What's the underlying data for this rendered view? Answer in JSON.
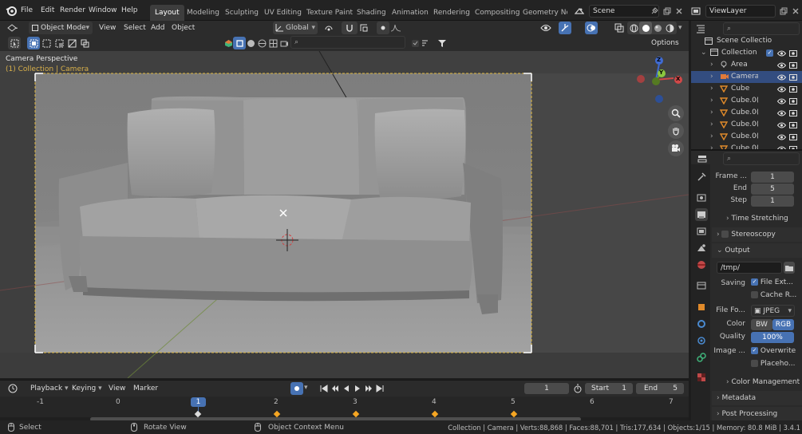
{
  "app": {
    "menus": [
      "File",
      "Edit",
      "Render",
      "Window",
      "Help"
    ],
    "workspaces": [
      "Layout",
      "Modeling",
      "Sculpting",
      "UV Editing",
      "Texture Paint",
      "Shading",
      "Animation",
      "Rendering",
      "Compositing",
      "Geometry Noc"
    ],
    "active_workspace": "Layout",
    "scene_name": "Scene",
    "view_layer": "ViewLayer"
  },
  "viewport_header": {
    "mode": "Object Mode",
    "menus": [
      "View",
      "Select",
      "Add",
      "Object"
    ],
    "transform_orientation": "Global",
    "options_label": "Options"
  },
  "viewport": {
    "camera_label": "Camera Perspective",
    "collection_label": "(1) Collection | Camera",
    "axis_x": "X",
    "axis_y": "Y",
    "axis_z": "Z"
  },
  "outliner": {
    "root": "Scene Collectio",
    "items": [
      {
        "name": "Collection",
        "type": "collection",
        "selected": false
      },
      {
        "name": "Area",
        "type": "light",
        "selected": false
      },
      {
        "name": "Camera",
        "type": "camera",
        "selected": true
      },
      {
        "name": "Cube",
        "type": "mesh",
        "selected": false
      },
      {
        "name": "Cube.0(",
        "type": "mesh",
        "selected": false
      },
      {
        "name": "Cube.0(",
        "type": "mesh",
        "selected": false
      },
      {
        "name": "Cube.0(",
        "type": "mesh",
        "selected": false
      },
      {
        "name": "Cube.0(",
        "type": "mesh",
        "selected": false
      },
      {
        "name": "Cube.0(",
        "type": "mesh",
        "selected": false
      }
    ]
  },
  "properties": {
    "frame_start_label": "Frame ...",
    "frame_start": "1",
    "frame_end_label": "End",
    "frame_end": "5",
    "frame_step_label": "Step",
    "frame_step": "1",
    "time_stretching": "Time Stretching",
    "stereoscopy": "Stereoscopy",
    "output_label": "Output",
    "output_path": "/tmp/",
    "saving_label": "Saving",
    "file_extensions": "File Ext...",
    "cache_result": "Cache R...",
    "file_format_label": "File Fo...",
    "file_format": "JPEG",
    "color_label": "Color",
    "color_bw": "BW",
    "color_rgb": "RGB",
    "quality_label": "Quality",
    "quality": "100%",
    "image_label": "Image ...",
    "overwrite": "Overwrite",
    "placeholders": "Placeho...",
    "color_management": "Color Management",
    "metadata": "Metadata",
    "post_processing": "Post Processing"
  },
  "timeline": {
    "menus": [
      "Playback",
      "Keying",
      "View",
      "Marker"
    ],
    "current_frame": "1",
    "start_label": "Start",
    "start": "1",
    "end_label": "End",
    "end": "5",
    "ruler": [
      "-1",
      "0",
      "1",
      "2",
      "3",
      "4",
      "5",
      "6",
      "7"
    ],
    "playhead": "1"
  },
  "status": {
    "select": "Select",
    "rotate": "Rotate View",
    "context_menu": "Object Context Menu",
    "stats": "Collection | Camera | Verts:88,868 | Faces:88,701 | Tris:177,634 | Objects:1/15 | Memory: 80.8 MiB | 3.4.1"
  },
  "colors": {
    "accent": "#4772b3",
    "selection_orange": "#f5a623",
    "camera_frame": "#e0b840"
  }
}
